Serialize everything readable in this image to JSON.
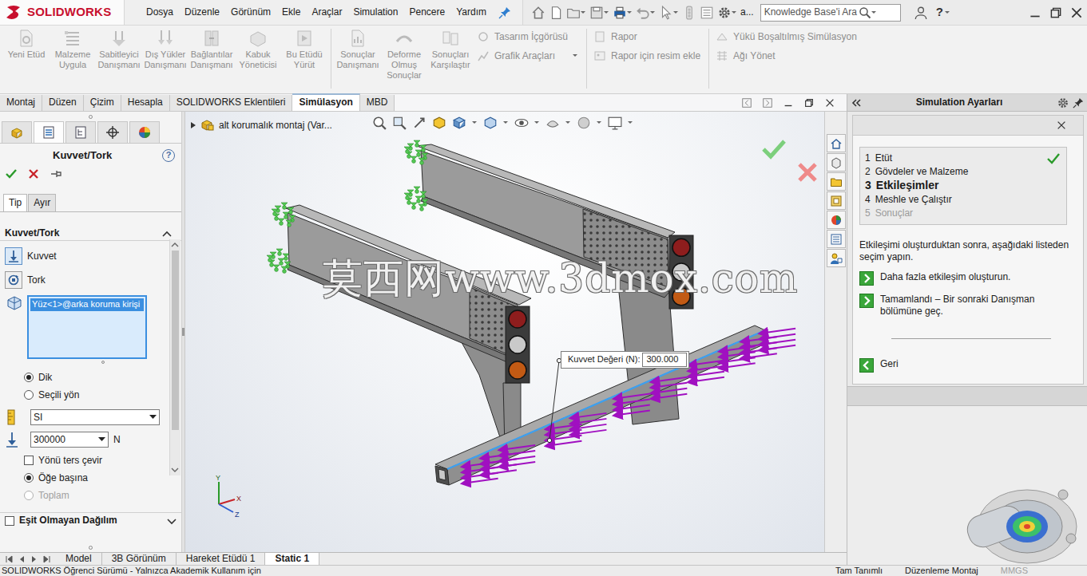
{
  "app": {
    "logo": "SOLIDWORKS"
  },
  "menu": [
    "Dosya",
    "Düzenle",
    "Görünüm",
    "Ekle",
    "Araçlar",
    "Simulation",
    "Pencere",
    "Yardım"
  ],
  "title_bar": {
    "overflow": "a...",
    "help": "?"
  },
  "search": {
    "placeholder": "Knowledge Base'i Ara"
  },
  "ribbon": {
    "large": [
      {
        "label": "Yeni Etüd",
        "disabled": true
      },
      {
        "label": "Malzeme Uygula",
        "disabled": true
      },
      {
        "label": "Sabitleyici Danışmanı",
        "disabled": true
      },
      {
        "label": "Dış Yükler Danışmanı",
        "disabled": true
      },
      {
        "label": "Bağlantılar Danışmanı",
        "disabled": true
      },
      {
        "label": "Kabuk Yöneticisi",
        "disabled": true
      },
      {
        "label": "Bu Etüdü Yürüt",
        "disabled": true
      },
      {
        "label": "Sonuçlar Danışmanı",
        "disabled": true
      },
      {
        "label": "Deforme Olmuş Sonuçlar",
        "disabled": true
      },
      {
        "label": "Sonuçları Karşılaştır",
        "disabled": true
      }
    ],
    "groups": [
      [
        {
          "label": "Tasarım İçgörüsü",
          "disabled": true
        },
        {
          "label": "Grafik Araçları",
          "disabled": true
        }
      ],
      [
        {
          "label": "Rapor",
          "disabled": true
        },
        {
          "label": "Rapor için resim ekle",
          "disabled": true
        }
      ],
      [
        {
          "label": "Yükü Boşaltılmış Simülasyon",
          "disabled": true
        },
        {
          "label": "Ağı Yönet",
          "disabled": true
        }
      ]
    ]
  },
  "command_tabs": [
    {
      "label": "Montaj",
      "selected": false
    },
    {
      "label": "Düzen",
      "selected": false
    },
    {
      "label": "Çizim",
      "selected": false
    },
    {
      "label": "Hesapla",
      "selected": false
    },
    {
      "label": "SOLIDWORKS Eklentileri",
      "selected": false
    },
    {
      "label": "Simülasyon",
      "selected": true
    },
    {
      "label": "MBD",
      "selected": false
    }
  ],
  "property_manager": {
    "panel_tabs": [
      {
        "selected": false
      },
      {
        "selected": true
      },
      {
        "selected": false
      },
      {
        "selected": false
      },
      {
        "selected": false
      }
    ],
    "title": "Kuvvet/Tork",
    "help": "?",
    "tabs": [
      {
        "label": "Tip",
        "selected": true
      },
      {
        "label": "Ayır",
        "selected": false
      }
    ],
    "section": {
      "title": "Kuvvet/Tork",
      "expanded": true
    },
    "load_types": [
      {
        "label": "Kuvvet",
        "selected": true
      },
      {
        "label": "Tork",
        "selected": false
      }
    ],
    "selection": [
      {
        "label": "Yüz<1>@arka koruma kirişi",
        "selected": true
      }
    ],
    "direction": [
      {
        "label": "Dik",
        "selected": true
      },
      {
        "label": "Seçili yön",
        "selected": false
      }
    ],
    "units": "SI",
    "value": "300000",
    "unit": "N",
    "reverse": {
      "label": "Yönü ters çevir",
      "checked": false
    },
    "distribution": [
      {
        "label": "Öğe başına",
        "selected": true,
        "disabled": false
      },
      {
        "label": "Toplam",
        "selected": false,
        "disabled": true
      }
    ],
    "nonuniform": {
      "label": "Eşit Olmayan Dağılım",
      "checked": false,
      "expanded": false
    },
    "scroll_level": 0.9
  },
  "viewport": {
    "tree_label": "alt korumalık montaj (Var...",
    "tooltip": {
      "label": "Kuvvet Değeri (N):",
      "value": "300.000"
    },
    "watermark": "莫西网www.3dmox.com",
    "triad": [
      "Y",
      "X",
      "Z"
    ]
  },
  "task_pane": {
    "title": "Simulation Ayarları",
    "steps": [
      {
        "number": "1",
        "label": "Etüt",
        "done": true,
        "current": false,
        "disabled": false
      },
      {
        "number": "2",
        "label": "Gövdeler ve Malzeme",
        "done": false,
        "current": false,
        "disabled": false
      },
      {
        "number": "3",
        "label": "Etkileşimler",
        "done": false,
        "current": true,
        "disabled": false
      },
      {
        "number": "4",
        "label": "Meshle ve Çalıştır",
        "done": false,
        "current": false,
        "disabled": false
      },
      {
        "number": "5",
        "label": "Sonuçlar",
        "done": false,
        "current": false,
        "disabled": true
      }
    ],
    "instruction": "Etkileşimi oluşturduktan sonra, aşağıdaki listeden seçim yapın.",
    "actions": [
      {
        "label": "Daha fazla etkileşim oluşturun.",
        "kind": "next"
      },
      {
        "label": "Tamamlandı – Bir sonraki Danışman bölümüne geç.",
        "kind": "next"
      },
      {
        "label": "Geri",
        "kind": "back"
      }
    ]
  },
  "bottom_tabs": [
    {
      "label": "Model",
      "selected": false
    },
    {
      "label": "3B Görünüm",
      "selected": false
    },
    {
      "label": "Hareket Etüdü 1",
      "selected": false
    },
    {
      "label": "Static 1",
      "selected": true
    }
  ],
  "status_bar": {
    "left": "SOLIDWORKS Öğrenci Sürümü - Yalnızca Akademik Kullanım için",
    "right": [
      {
        "label": "Tam Tanımlı",
        "disabled": false
      },
      {
        "label": "Düzenleme Montaj",
        "disabled": false
      },
      {
        "label": "MMGS",
        "disabled": true
      }
    ]
  }
}
